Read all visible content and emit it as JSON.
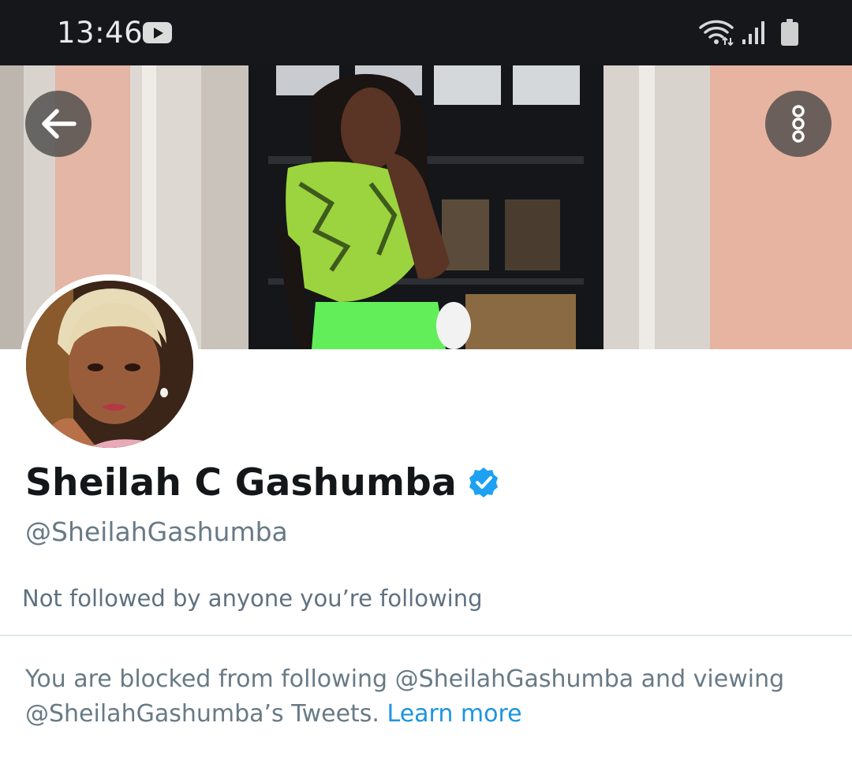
{
  "status_bar": {
    "time": "13:46",
    "icons": [
      "youtube-notification-icon",
      "wifi-icon",
      "cell-signal-icon",
      "battery-icon"
    ]
  },
  "header": {
    "back_icon": "arrow-left-icon",
    "more_icon": "more-vertical-icon"
  },
  "profile": {
    "display_name": "Sheilah C Gashumba",
    "verified": true,
    "handle": "@SheilahGashumba",
    "followed_by_text": "Not followed by anyone you’re following"
  },
  "blocked_notice": {
    "text_part_1": "You are blocked from following @SheilahGashumba and viewing",
    "text_part_2": "@SheilahGashumba’s Tweets.",
    "learn_more_label": "Learn more"
  },
  "colors": {
    "status_bar_bg": "#16171b",
    "text_primary": "#14171a",
    "text_secondary": "#687a86",
    "link": "#1b95e0",
    "verified_badge": "#1da1f2"
  }
}
